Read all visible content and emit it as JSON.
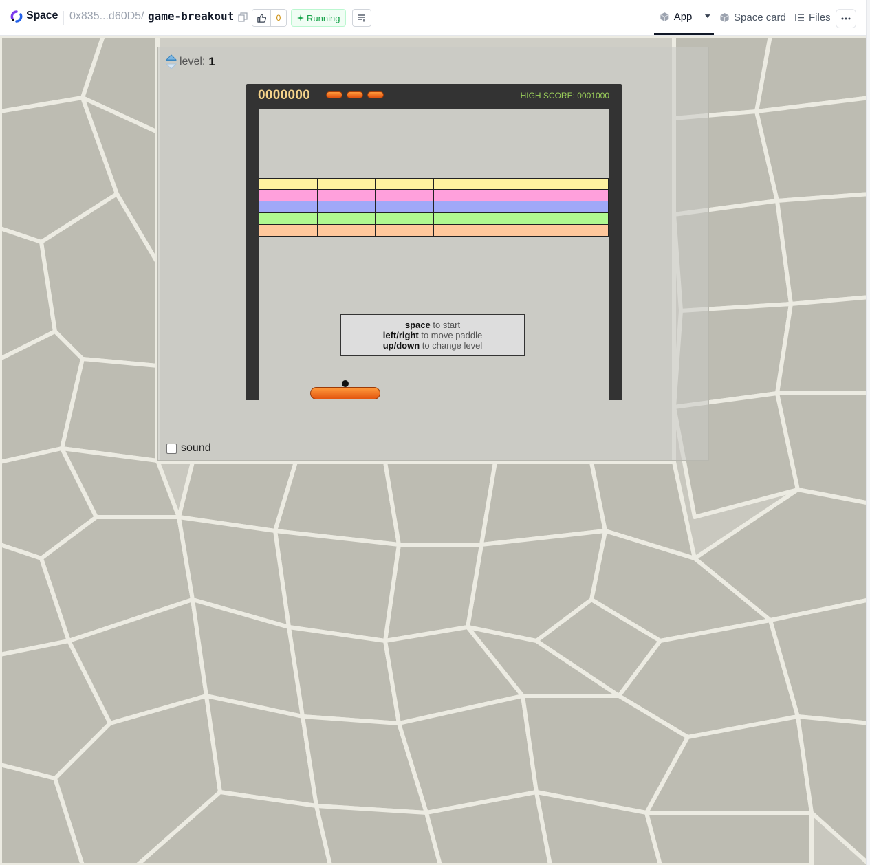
{
  "header": {
    "brand": "Space",
    "owner": "0x835...d60D5",
    "separator": "/",
    "repo": "game-breakout",
    "like_count": "0",
    "status": "Running",
    "tabs": [
      {
        "label": "App",
        "icon": "cube-icon",
        "active": true
      },
      {
        "label": "Space card",
        "icon": "cube-icon",
        "active": false
      },
      {
        "label": "Files",
        "icon": "files-icon",
        "active": false
      }
    ]
  },
  "app": {
    "level_label": "level:",
    "level_value": "1",
    "sound_label": "sound",
    "sound_checked": false
  },
  "game": {
    "score": "0000000",
    "lives": 3,
    "high_score_label": "HIGH SCORE: 0001000",
    "brick_colors": [
      "#fff2a0",
      "#ffa0dc",
      "#a0a8f8",
      "#b0f890",
      "#ffc89c"
    ],
    "bricks_per_row": 6,
    "help": [
      {
        "key": "space",
        "text": " to start"
      },
      {
        "key": "left/right",
        "text": " to move paddle"
      },
      {
        "key": "up/down",
        "text": " to change level"
      }
    ]
  },
  "colors": {
    "accent": "#111827",
    "status_green": "#16a34a",
    "board_frame": "#333333",
    "paddle": "#f07020"
  }
}
